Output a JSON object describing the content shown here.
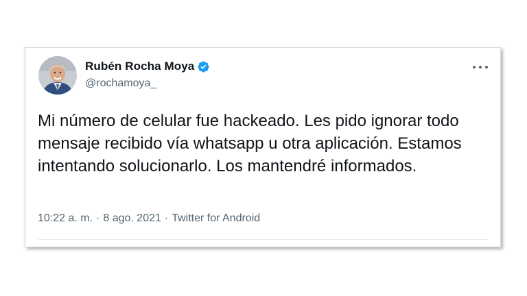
{
  "tweet": {
    "author": {
      "display_name": "Rubén Rocha Moya",
      "handle": "@rochamoya_",
      "verified": true,
      "avatar_icon": "profile-photo-icon"
    },
    "text": "Mi número de celular fue hackeado. Les pido ignorar todo mensaje recibido vía whatsapp u otra aplicación. Estamos intentando solucionarlo. Los mantendré informados.",
    "time": "10:22 a. m.",
    "date": "8 ago. 2021",
    "source": "Twitter for Android",
    "separator": "·"
  },
  "colors": {
    "verified_badge": "#1d9bf0",
    "text_primary": "#0f1419",
    "text_secondary": "#536471"
  }
}
